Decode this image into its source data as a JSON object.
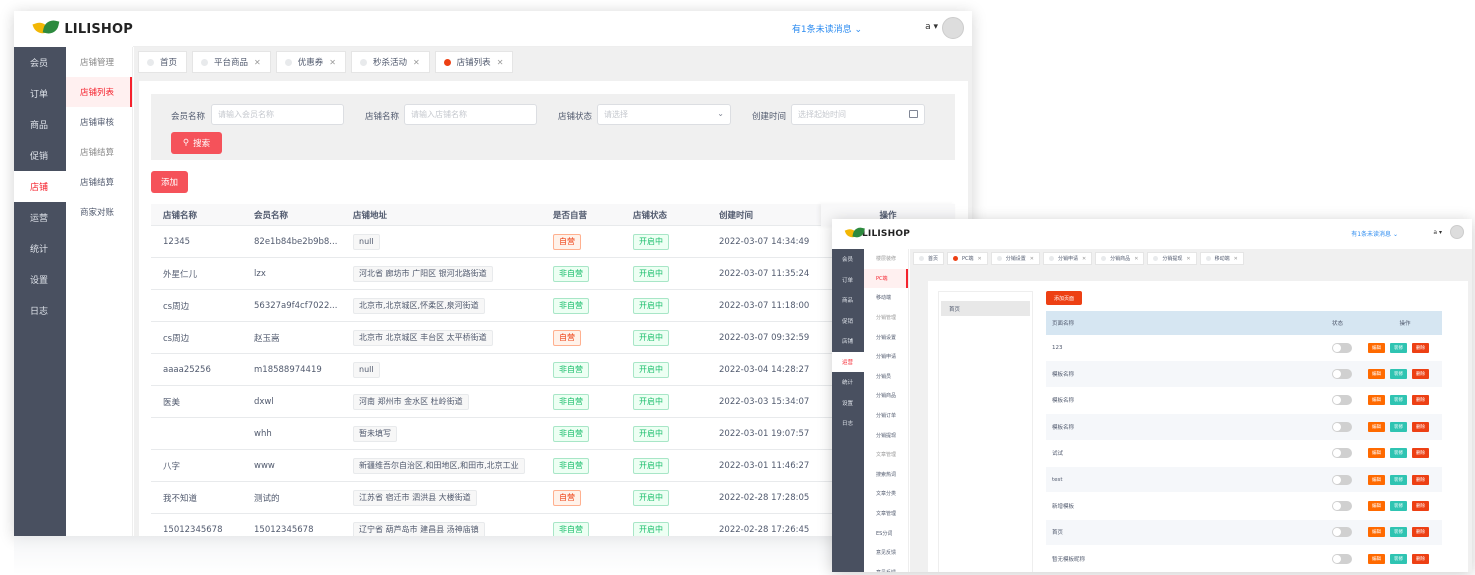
{
  "main": {
    "logo_text": "LILISHOP",
    "header": {
      "notice": "有1条未读消息 ⌄",
      "user": "a ▾"
    },
    "nav_primary": [
      "会员",
      "订单",
      "商品",
      "促销",
      "店铺",
      "运营",
      "统计",
      "设置",
      "日志"
    ],
    "nav_primary_active": 4,
    "nav_secondary": [
      {
        "label": "店铺管理",
        "state": "muted"
      },
      {
        "label": "店铺列表",
        "state": "active"
      },
      {
        "label": "店铺审核",
        "state": "normal"
      },
      {
        "label": "店铺结算",
        "state": "muted"
      },
      {
        "label": "店铺结算",
        "state": "normal"
      },
      {
        "label": "商家对账",
        "state": "normal"
      }
    ],
    "tabs": [
      {
        "label": "首页",
        "closable": false,
        "active": false
      },
      {
        "label": "平台商品",
        "closable": true,
        "active": false
      },
      {
        "label": "优惠券",
        "closable": true,
        "active": false
      },
      {
        "label": "秒杀活动",
        "closable": true,
        "active": false
      },
      {
        "label": "店铺列表",
        "closable": true,
        "active": true
      }
    ],
    "filters": {
      "member_label": "会员名称",
      "member_placeholder": "请输入会员名称",
      "store_label": "店铺名称",
      "store_placeholder": "请输入店铺名称",
      "status_label": "店铺状态",
      "status_placeholder": "请选择",
      "created_label": "创建时间",
      "created_placeholder": "选择起始时间",
      "search_label": "搜索",
      "add_label": "添加"
    },
    "table": {
      "columns": [
        "店铺名称",
        "会员名称",
        "店铺地址",
        "是否自营",
        "店铺状态",
        "创建时间",
        "操作"
      ],
      "rows": [
        {
          "store": "12345",
          "member": "82e1b84be2b9b8...",
          "address": "null",
          "self": "自营",
          "status": "开启中",
          "created": "2022-03-07 14:34:49"
        },
        {
          "store": "外星仁儿",
          "member": "lzx",
          "address": "河北省 廊坊市 广阳区 银河北路街道",
          "self": "非自营",
          "status": "开启中",
          "created": "2022-03-07 11:35:24"
        },
        {
          "store": "cs周边",
          "member": "56327a9f4cf7022...",
          "address": "北京市,北京城区,怀柔区,泉河街道",
          "self": "非自营",
          "status": "开启中",
          "created": "2022-03-07 11:18:00"
        },
        {
          "store": "cs周边",
          "member": "赵玉嵩",
          "address": "北京市 北京城区 丰台区 太平桥街道",
          "self": "自营",
          "status": "开启中",
          "created": "2022-03-07 09:32:59"
        },
        {
          "store": "aaaa25256",
          "member": "m18588974419",
          "address": "null",
          "self": "非自营",
          "status": "开启中",
          "created": "2022-03-04 14:28:27"
        },
        {
          "store": "医美",
          "member": "dxwl",
          "address": "河南 郑州市 金水区 杜岭街道",
          "self": "非自营",
          "status": "开启中",
          "created": "2022-03-03 15:34:07"
        },
        {
          "store": "",
          "member": "whh",
          "address": "暂未填写",
          "self": "非自营",
          "status": "开启中",
          "created": "2022-03-01 19:07:57"
        },
        {
          "store": "八字",
          "member": "www",
          "address": "新疆维吾尔自治区,和田地区,和田市,北京工业",
          "self": "非自营",
          "status": "开启中",
          "created": "2022-03-01 11:46:27"
        },
        {
          "store": "我不知道",
          "member": "测试的",
          "address": "江苏省 宿迁市 泗洪县 大楼街道",
          "self": "自营",
          "status": "开启中",
          "created": "2022-02-28 17:28:05"
        },
        {
          "store": "15012345678",
          "member": "15012345678",
          "address": "辽宁省 葫芦岛市 建昌县 汤神庙镇",
          "self": "非自营",
          "status": "开启中",
          "created": "2022-02-28 17:26:45"
        }
      ]
    }
  },
  "secondary": {
    "logo_text": "LILISHOP",
    "header": {
      "notice": "有1条未读消息 ⌄",
      "user": "a ▾"
    },
    "nav_primary": [
      "会员",
      "订单",
      "商品",
      "促销",
      "店铺",
      "运营",
      "统计",
      "设置",
      "日志"
    ],
    "nav_primary_active": 5,
    "nav_secondary": [
      {
        "label": "楼层装修",
        "state": "muted"
      },
      {
        "label": "PC端",
        "state": "active"
      },
      {
        "label": "移动端",
        "state": "normal"
      },
      {
        "label": "分销管理",
        "state": "muted"
      },
      {
        "label": "分销设置",
        "state": "normal"
      },
      {
        "label": "分销申请",
        "state": "normal"
      },
      {
        "label": "分销员",
        "state": "normal"
      },
      {
        "label": "分销商品",
        "state": "normal"
      },
      {
        "label": "分销订单",
        "state": "normal"
      },
      {
        "label": "分销提现",
        "state": "normal"
      },
      {
        "label": "文章管理",
        "state": "muted"
      },
      {
        "label": "搜索热词",
        "state": "normal"
      },
      {
        "label": "文章分类",
        "state": "normal"
      },
      {
        "label": "文章管理",
        "state": "normal"
      },
      {
        "label": "ES分词",
        "state": "normal"
      },
      {
        "label": "意见反馈",
        "state": "normal"
      },
      {
        "label": "意见反馈",
        "state": "normal"
      }
    ],
    "tabs": [
      {
        "label": "首页",
        "closable": false,
        "active": false
      },
      {
        "label": "PC端",
        "closable": true,
        "active": true
      },
      {
        "label": "分销设置",
        "closable": true,
        "active": false
      },
      {
        "label": "分销申请",
        "closable": true,
        "active": false
      },
      {
        "label": "分销商品",
        "closable": true,
        "active": false
      },
      {
        "label": "分销提现",
        "closable": true,
        "active": false
      },
      {
        "label": "移动端",
        "closable": true,
        "active": false
      }
    ],
    "tree_item": "首页",
    "add_page_label": "添加页面",
    "table": {
      "columns": [
        "页面名称",
        "状态",
        "操作"
      ],
      "rows": [
        {
          "name": "123"
        },
        {
          "name": "模板名称"
        },
        {
          "name": "模板名称"
        },
        {
          "name": "模板名称"
        },
        {
          "name": "试试"
        },
        {
          "name": "test"
        },
        {
          "name": "新增模板"
        },
        {
          "name": "首页"
        },
        {
          "name": "暂无模板昵称"
        }
      ],
      "actions": [
        "编辑",
        "装修",
        "删除"
      ]
    }
  }
}
